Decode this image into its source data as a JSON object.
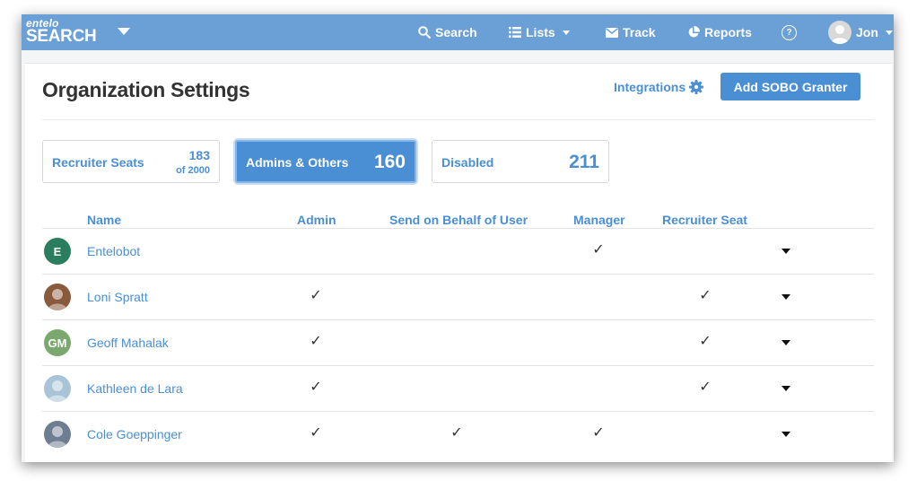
{
  "app": {
    "logo_small": "entelo",
    "logo_big": "SEARCH"
  },
  "nav": {
    "search": "Search",
    "lists": "Lists",
    "track": "Track",
    "reports": "Reports",
    "help": "?",
    "user": "Jon"
  },
  "page": {
    "title": "Organization Settings",
    "integrations": "Integrations",
    "add_button": "Add SOBO Granter"
  },
  "stats": [
    {
      "label": "Recruiter Seats",
      "value": "183",
      "sub": "of 2000"
    },
    {
      "label": "Admins & Others",
      "value": "160"
    },
    {
      "label": "Disabled",
      "value": "211"
    }
  ],
  "table": {
    "headers": {
      "name": "Name",
      "admin": "Admin",
      "sobo": "Send on Behalf of User",
      "manager": "Manager",
      "recruiter": "Recruiter Seat"
    },
    "check_symbol": "✓",
    "rows": [
      {
        "name": "Entelobot",
        "initials": "E",
        "avatar_color": "#2a7d5f",
        "admin": false,
        "sobo": false,
        "manager": true,
        "recruiter": false
      },
      {
        "name": "Loni Spratt",
        "initials": "",
        "avatar_color": "#8a5a3c",
        "admin": true,
        "sobo": false,
        "manager": false,
        "recruiter": true
      },
      {
        "name": "Geoff Mahalak",
        "initials": "GM",
        "avatar_color": "#7aa86e",
        "admin": true,
        "sobo": false,
        "manager": false,
        "recruiter": true
      },
      {
        "name": "Kathleen de Lara",
        "initials": "",
        "avatar_color": "#a9c4d6",
        "admin": true,
        "sobo": false,
        "manager": false,
        "recruiter": true
      },
      {
        "name": "Cole Goeppinger",
        "initials": "",
        "avatar_color": "#6f7d92",
        "admin": true,
        "sobo": true,
        "manager": true,
        "recruiter": false
      }
    ]
  },
  "colors": {
    "topbar": "#6aa0d6",
    "accent": "#4a8fd4"
  }
}
